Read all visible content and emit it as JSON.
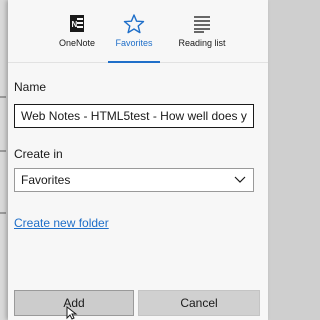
{
  "tabs": [
    {
      "label": "OneNote",
      "icon": "onenote-icon"
    },
    {
      "label": "Favorites",
      "icon": "star-icon",
      "selected": true
    },
    {
      "label": "Reading list",
      "icon": "reading-list-icon"
    }
  ],
  "form": {
    "name_label": "Name",
    "name_value": "Web Notes - HTML5test - How well does y",
    "create_in_label": "Create in",
    "create_in_value": "Favorites",
    "create_folder_link": "Create new folder"
  },
  "buttons": {
    "add": "Add",
    "cancel": "Cancel"
  },
  "colors": {
    "accent": "#1f6fc9",
    "panel_bg": "#f7f7f7",
    "button_bg": "#d0d0d0"
  }
}
